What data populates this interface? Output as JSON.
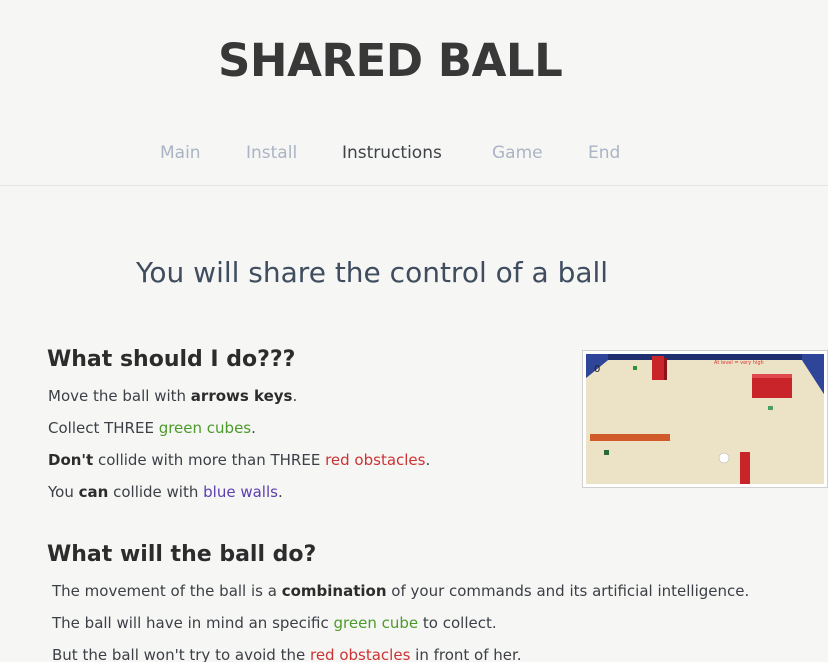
{
  "site": {
    "title": "SHARED BALL"
  },
  "nav": {
    "items": [
      "Main",
      "Install",
      "Instructions",
      "Game",
      "End"
    ],
    "active": "Instructions"
  },
  "headline": "You will share the control of a ball",
  "section1": {
    "title": "What should I do???",
    "line1": {
      "pre": "Move the ball with ",
      "bold": "arrows keys",
      "post": "."
    },
    "line2": {
      "pre": "Collect THREE ",
      "color": "green cubes",
      "post": "."
    },
    "line3": {
      "bold": "Don't",
      "pre": " collide with more than THREE ",
      "color": "red obstacles",
      "post": "."
    },
    "line4": {
      "pre": "You ",
      "bold": "can",
      "mid": " collide with ",
      "color": "blue walls",
      "post": "."
    }
  },
  "section2": {
    "title": "What will the ball do?",
    "line1": {
      "pre": "The movement of the ball is a ",
      "bold": "combination",
      "post": " of your commands and its artificial intelligence."
    },
    "line2": {
      "pre": "The ball will have in mind an specific ",
      "color": "green cube",
      "post": " to collect."
    },
    "line3": {
      "pre": "But the ball won't try to avoid the ",
      "color": "red obstacles",
      "post": " in front of her."
    }
  },
  "game_preview": {
    "score_label": "0",
    "hud_right": "At level = very high",
    "icon": "game-screenshot-icon"
  },
  "colors": {
    "accent_green": "#4c9a2a",
    "accent_red": "#cc3333",
    "accent_blue": "#5a3fb0",
    "nav_inactive": "#aab4c4",
    "nav_active": "#3f4348"
  }
}
